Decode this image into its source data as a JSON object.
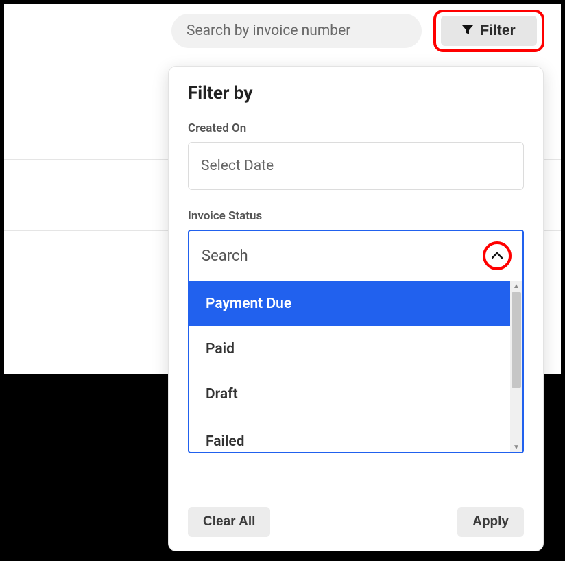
{
  "search": {
    "placeholder": "Search by invoice number"
  },
  "filterButton": {
    "label": "Filter"
  },
  "panel": {
    "title": "Filter by",
    "createdOn": {
      "label": "Created On",
      "placeholder": "Select Date"
    },
    "invoiceStatus": {
      "label": "Invoice Status",
      "searchPlaceholder": "Search",
      "selectedIndex": 0,
      "options": [
        "Payment Due",
        "Paid",
        "Draft",
        "Failed"
      ]
    },
    "actions": {
      "clear": "Clear All",
      "apply": "Apply"
    }
  }
}
